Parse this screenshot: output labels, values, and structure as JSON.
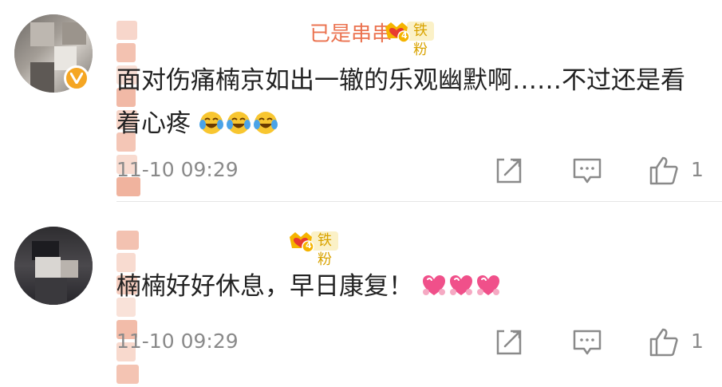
{
  "comments": [
    {
      "username": "[censored]…川已是串串",
      "username_visible": "已是串串",
      "badge_level": "4",
      "badge_label": "铁粉",
      "verified": true,
      "text": "面对伤痛楠京如出一辙的乐观幽默啊……不过还是看着心疼",
      "emoji": [
        "laugh-cry-icon",
        "laugh-cry-icon",
        "laugh-cry-icon"
      ],
      "time": "11-10 09:29",
      "like_count": "1"
    },
    {
      "username": "[censored]",
      "badge_level": "4",
      "badge_label": "铁粉",
      "verified": false,
      "text": "楠楠好好休息，早日康复！",
      "emoji": [
        "pink-heart-icon",
        "pink-heart-icon",
        "pink-heart-icon"
      ],
      "time": "11-10 09:29",
      "like_count": "1"
    }
  ],
  "colors": {
    "username": "#eb7350",
    "badge_text": "#d9a300",
    "badge_bg": "#fbf1c7",
    "meta": "#8a8a8a",
    "verified": "#f5a623"
  }
}
